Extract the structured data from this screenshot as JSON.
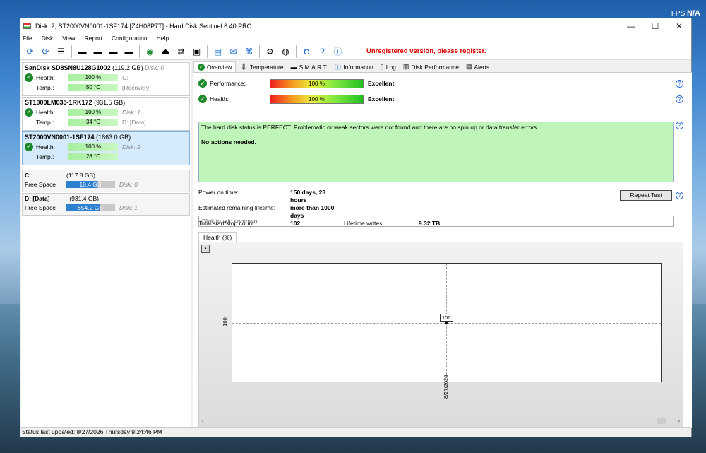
{
  "overlay": {
    "fps_label": "FPS",
    "fps_value": "N/A"
  },
  "window": {
    "title": "Disk: 2, ST2000VN0001-1SF174 [Z4H08P7T]  -  Hard Disk Sentinel 6.40 PRO",
    "controls": {
      "minimize": "—",
      "maximize": "☐",
      "close": "✕"
    }
  },
  "menu": [
    "File",
    "Disk",
    "View",
    "Report",
    "Configuration",
    "Help"
  ],
  "toolbar": {
    "unregistered": "Unregistered version, please register."
  },
  "disks": [
    {
      "name": "SanDisk SD8SN8U128G1002",
      "size": "(119.2 GB)",
      "disk": "Disk: 0",
      "health": "100 %",
      "health_extra": "C:",
      "temp": "50 °C",
      "temp_extra": "[Recovery]"
    },
    {
      "name": "ST1000LM035-1RK172",
      "size": "(931.5 GB)",
      "disk": "Disk: 1",
      "health": "100 %",
      "health_extra": "Disk: 1",
      "temp": "34 °C",
      "temp_extra": "D: [Data]"
    },
    {
      "name": "ST2000VN0001-1SF174",
      "size": "(1863.0 GB)",
      "disk": "",
      "health": "100 %",
      "health_extra": "Disk: 2",
      "temp": "28 °C",
      "temp_extra": ""
    }
  ],
  "labels": {
    "health": "Health:",
    "temp": "Temp.:",
    "free_space": "Free Space"
  },
  "volumes": [
    {
      "name": "C:",
      "size": "(117.8 GB)",
      "free": "18.4 GB",
      "disk": "Disk: 0"
    },
    {
      "name": "D: [Data]",
      "size": "(931.4 GB)",
      "free": "654.2 GB",
      "disk": "Disk: 1"
    }
  ],
  "tabs": [
    "Overview",
    "Temperature",
    "S.M.A.R.T.",
    "Information",
    "Log",
    "Disk Performance",
    "Alerts"
  ],
  "overview": {
    "performance_label": "Performance:",
    "performance_value": "100 %",
    "performance_level": "Excellent",
    "health_label": "Health:",
    "health_value": "100 %",
    "health_level": "Excellent",
    "status_text": "The hard disk status is PERFECT. Problematic or weak sectors were not found and there are no spin up or data transfer errors.",
    "actions_text": "No actions needed.",
    "power_on_label": "Power on time:",
    "power_on_value": "150 days, 23 hours",
    "lifetime_label": "Estimated remaining lifetime:",
    "lifetime_value": "more than 1000 days",
    "startstop_label": "Total start/stop count:",
    "startstop_value": "102",
    "writes_label": "Lifetime writes:",
    "writes_value": "9.32 TB",
    "repeat_button": "Repeat Test",
    "comment_placeholder": "Click to add comment ..."
  },
  "chart_tab": "Health (%)",
  "chart_data": {
    "type": "line",
    "x": [
      "8/27/2026"
    ],
    "series": [
      {
        "values": [
          100
        ]
      }
    ],
    "ylabel": "",
    "xlabel": "",
    "point_label": "100",
    "y_tick": "100"
  },
  "statusbar": "Status last updated: 8/27/2026 Thursday 9:24:46 PM"
}
